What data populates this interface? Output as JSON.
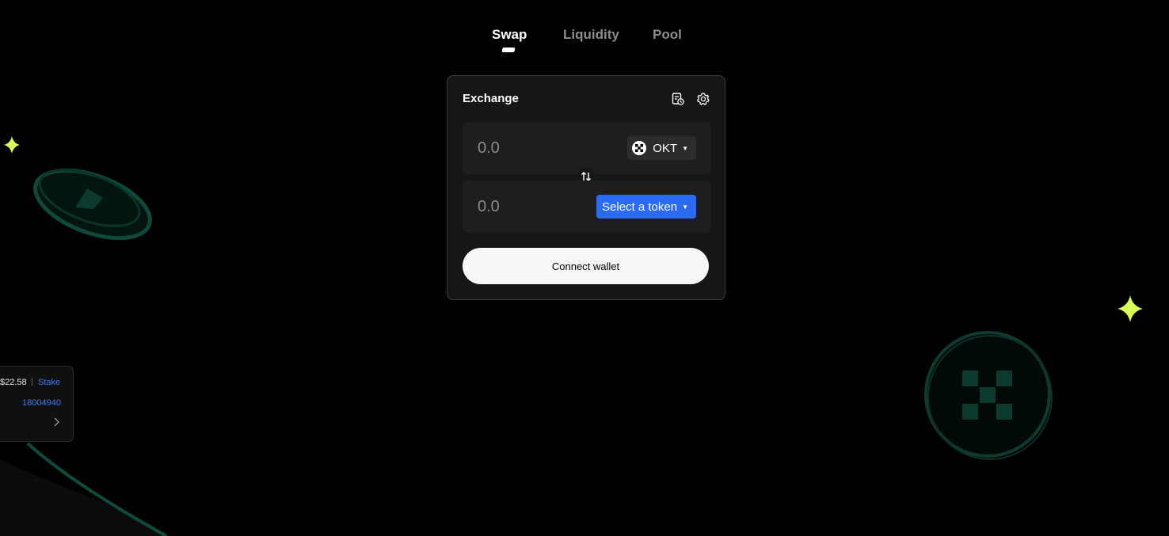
{
  "tabs": [
    {
      "label": "Swap",
      "active": true
    },
    {
      "label": "Liquidity",
      "active": false
    },
    {
      "label": "Pool",
      "active": false
    }
  ],
  "exchange": {
    "title": "Exchange",
    "from": {
      "placeholder": "0.0",
      "token": "OKT"
    },
    "to": {
      "placeholder": "0.0",
      "token_button": "Select a token"
    },
    "connect_button": "Connect wallet"
  },
  "info_widget": {
    "price": "$22.58",
    "separator": "|",
    "stake_link": "Stake",
    "number": "18004940"
  },
  "colors": {
    "accent_blue": "#2a6af5",
    "sparkle": "#d8ff5a",
    "deco_teal": "#0f3d33"
  }
}
